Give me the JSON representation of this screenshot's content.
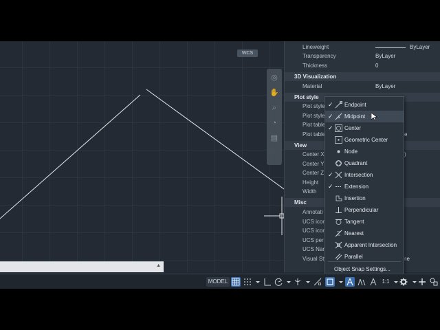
{
  "viewport": {
    "wcs_label": "WCS"
  },
  "properties": {
    "rows_top": [
      {
        "label": "Lineweight",
        "value": "ByLayer"
      },
      {
        "label": "Transparency",
        "value": "ByLayer"
      },
      {
        "label": "Thickness",
        "value": "0"
      }
    ],
    "sections": {
      "viz": "3D Visualization",
      "plot": "Plot style",
      "view": "View",
      "misc": "Misc"
    },
    "material": {
      "label": "Material",
      "value": "ByLayer"
    },
    "plot_rows": [
      "Plot style",
      "Plot style",
      "Plot table",
      "Plot table"
    ],
    "plot_table_tail": "e",
    "view_rows": [
      "Center X",
      "Center Y",
      "Center Z",
      "Height",
      "Width"
    ],
    "center_x_tail": ")",
    "misc_rows": [
      "Annotati",
      "UCS icon",
      "UCS icon",
      "UCS per",
      "UCS Nan",
      "Visual Sty"
    ],
    "visual_style_tail": "ne"
  },
  "osnap_menu": {
    "items": [
      {
        "label": "Endpoint",
        "checked": true,
        "icon": "endpoint-icon"
      },
      {
        "label": "Midpoint",
        "checked": true,
        "icon": "midpoint-icon"
      },
      {
        "label": "Center",
        "checked": true,
        "icon": "center-icon"
      },
      {
        "label": "Geometric Center",
        "checked": false,
        "icon": "geometric-center-icon"
      },
      {
        "label": "Node",
        "checked": false,
        "icon": "node-icon"
      },
      {
        "label": "Quadrant",
        "checked": false,
        "icon": "quadrant-icon"
      },
      {
        "label": "Intersection",
        "checked": true,
        "icon": "intersection-icon"
      },
      {
        "label": "Extension",
        "checked": true,
        "icon": "extension-icon"
      },
      {
        "label": "Insertion",
        "checked": false,
        "icon": "insertion-icon"
      },
      {
        "label": "Perpendicular",
        "checked": false,
        "icon": "perpendicular-icon"
      },
      {
        "label": "Tangent",
        "checked": false,
        "icon": "tangent-icon"
      },
      {
        "label": "Nearest",
        "checked": false,
        "icon": "nearest-icon"
      },
      {
        "label": "Apparent Intersection",
        "checked": false,
        "icon": "apparent-intersection-icon"
      },
      {
        "label": "Parallel",
        "checked": false,
        "icon": "parallel-icon"
      }
    ],
    "settings_label": "Object Snap Settings...",
    "hovered": "Midpoint",
    "check_glyph": "✓"
  },
  "status_bar": {
    "model_label": "MODEL",
    "scale_label": "1:1",
    "accent": "#3b6fb0"
  }
}
